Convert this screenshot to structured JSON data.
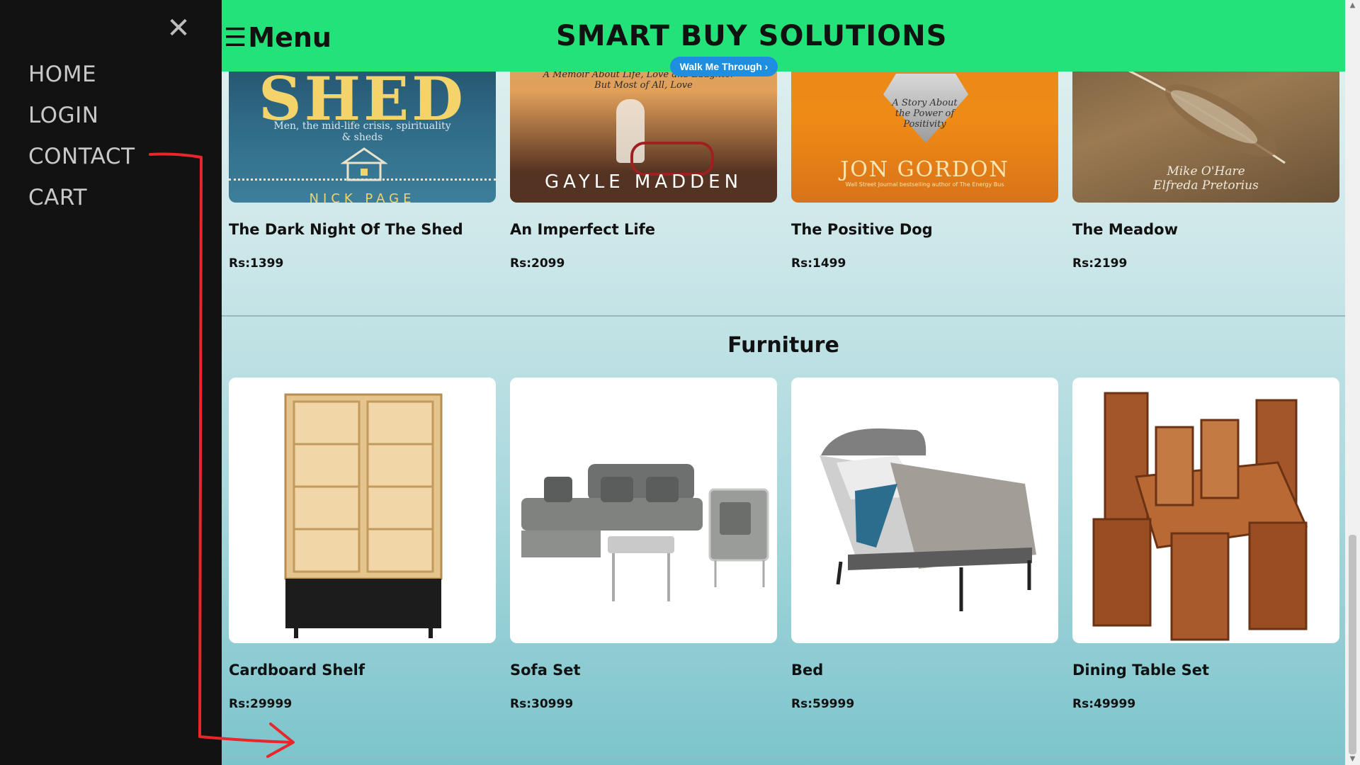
{
  "sidebar": {
    "close_symbol": "✕",
    "items": [
      {
        "label": "HOME"
      },
      {
        "label": "LOGIN"
      },
      {
        "label": "CONTACT"
      },
      {
        "label": "CART"
      }
    ]
  },
  "header": {
    "menu_icon": "☰",
    "menu_label": "Menu",
    "brand": "SMART BUY SOLUTIONS",
    "walk_button": "Walk Me Through ›"
  },
  "books": [
    {
      "title": "The Dark Night Of The Shed",
      "price": "Rs:1399",
      "cover_top": "SHED",
      "cover_sub": "Men, the mid-life crisis, spirituality & sheds",
      "cover_bottom": "NICK PAGE"
    },
    {
      "title": "An Imperfect Life",
      "price": "Rs:2099",
      "cover_top": "A Memoir About Life, Love and Laughter—But Most of All, Love",
      "cover_bottom": "GAYLE MADDEN"
    },
    {
      "title": "The Positive Dog",
      "price": "Rs:1499",
      "cover_top": "A Story About the Power of Positivity",
      "cover_bottom": "JON GORDON",
      "cover_sub": "Wall Street Journal bestselling author of The Energy Bus"
    },
    {
      "title": "The Meadow",
      "price": "Rs:2199",
      "cover_bottom": "Mike O'Hare Elfreda Pretorius"
    }
  ],
  "furniture_section": {
    "title": "Furniture",
    "items": [
      {
        "title": "Cardboard Shelf",
        "price": "Rs:29999"
      },
      {
        "title": "Sofa Set",
        "price": "Rs:30999"
      },
      {
        "title": "Bed",
        "price": "Rs:59999"
      },
      {
        "title": "Dining Table Set",
        "price": "Rs:49999"
      }
    ]
  },
  "colors": {
    "header_bg": "#24e27a",
    "sidebar_bg": "#121212",
    "walk_button_bg": "#1e8fe0",
    "annotation": "#e8262b"
  }
}
